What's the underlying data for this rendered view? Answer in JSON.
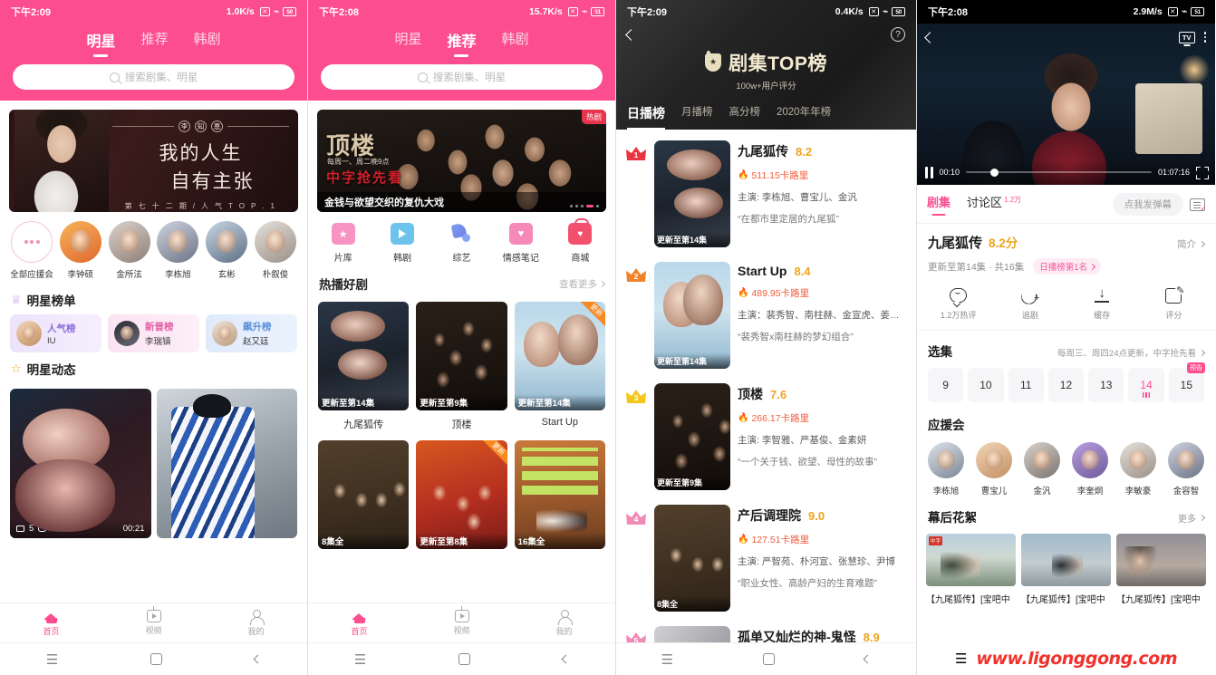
{
  "screen1": {
    "status": {
      "time": "下午2:09",
      "speed": "1.0K/s",
      "x_icon": "x-icon",
      "wifi": "wifi-icon",
      "battery": "50"
    },
    "tabs": [
      {
        "label": "明星",
        "active": true
      },
      {
        "label": "推荐",
        "active": false
      },
      {
        "label": "韩剧",
        "active": false
      }
    ],
    "search": {
      "placeholder": "搜索剧集、明星",
      "icon": "search-icon"
    },
    "banner": {
      "badge_chars": [
        "李",
        "知",
        "恩"
      ],
      "line1": "我的人生",
      "line2": "自有主张",
      "line3": "第 七 十 二 期 / 人 气 T O P . 1"
    },
    "avatars": [
      {
        "label": "全部应援会",
        "type": "more"
      },
      {
        "label": "李钟硕",
        "type": "photo"
      },
      {
        "label": "金所泫",
        "type": "photo"
      },
      {
        "label": "李栋旭",
        "type": "photo"
      },
      {
        "label": "玄彬",
        "type": "photo"
      },
      {
        "label": "朴叙俊",
        "type": "photo"
      }
    ],
    "star_rank": {
      "title": "明星榜单",
      "icon": "crown-icon",
      "cards": [
        {
          "name": "人气榜",
          "person": "IU"
        },
        {
          "name": "新晋榜",
          "person": "李瑞镇"
        },
        {
          "name": "飙升榜",
          "person": "赵又廷"
        }
      ]
    },
    "star_feed": {
      "title": "明星动态",
      "icon": "star-icon",
      "cards": [
        {
          "plays": "5",
          "comments": "0",
          "duration": "00:21"
        },
        {
          "plays": "",
          "comments": "",
          "duration": ""
        }
      ]
    },
    "tabbar": [
      {
        "label": "首页",
        "icon": "home-icon",
        "active": true
      },
      {
        "label": "视频",
        "icon": "tv-icon",
        "active": false
      },
      {
        "label": "我的",
        "icon": "person-icon",
        "active": false
      }
    ],
    "sysnav": [
      "menu-icon",
      "square-icon",
      "back-icon"
    ]
  },
  "screen2": {
    "status": {
      "time": "下午2:08",
      "speed": "15.7K/s",
      "battery": "51"
    },
    "tabs": [
      {
        "label": "明星",
        "active": false
      },
      {
        "label": "推荐",
        "active": true
      },
      {
        "label": "韩剧",
        "active": false
      }
    ],
    "search": {
      "placeholder": "搜索剧集、明星"
    },
    "banner": {
      "badge": "热剧",
      "title": "顶楼",
      "sub": "每周一、周二晚9点",
      "red": "中字抢先看",
      "footer": "金钱与欲望交织的复仇大戏"
    },
    "categories": [
      {
        "label": "片库",
        "icon": "folder-star-icon"
      },
      {
        "label": "韩剧",
        "icon": "play-icon"
      },
      {
        "label": "综艺",
        "icon": "mic-icon"
      },
      {
        "label": "情感笔记",
        "icon": "note-heart-icon"
      },
      {
        "label": "商城",
        "icon": "shop-bag-icon"
      }
    ],
    "hot": {
      "title": "热播好剧",
      "more": "查看更多",
      "row1": [
        {
          "name": "九尾狐传",
          "ep": "更新至第14集",
          "corner": ""
        },
        {
          "name": "顶楼",
          "ep": "更新至第9集",
          "corner": ""
        },
        {
          "name": "Start Up",
          "ep": "更新至第14集",
          "corner": "更新"
        }
      ],
      "row2": [
        {
          "name": "",
          "ep": "8集全",
          "corner": ""
        },
        {
          "name": "",
          "ep": "更新至第8集",
          "corner": "更新"
        },
        {
          "name": "",
          "ep": "16集全",
          "corner": ""
        }
      ]
    },
    "tabbar": [
      {
        "label": "首页",
        "active": true
      },
      {
        "label": "视频",
        "active": false
      },
      {
        "label": "我的",
        "active": false
      }
    ]
  },
  "screen3": {
    "status": {
      "time": "下午2:09",
      "speed": "0.4K/s",
      "battery": "50"
    },
    "header": {
      "back": "back-icon",
      "help": "?",
      "title": "剧集TOP榜",
      "medal": "medal-icon",
      "subtitle": "100w+用户评分"
    },
    "tabs": [
      {
        "label": "日播榜",
        "active": true
      },
      {
        "label": "月播榜",
        "active": false
      },
      {
        "label": "高分榜",
        "active": false
      },
      {
        "label": "2020年年榜",
        "active": false
      }
    ],
    "items": [
      {
        "rank": "1",
        "title": "九尾狐传",
        "score": "8.2",
        "heat": "511.15卡路里",
        "cast": "主演: 李栋旭、曹宝儿、金汎",
        "quote": "“在都市里定居的九尾狐”",
        "ep": "更新至第14集"
      },
      {
        "rank": "2",
        "title": "Start Up",
        "score": "8.4",
        "heat": "489.95卡路里",
        "cast": "主演：裴秀智、南柱赫、金宣虎、姜汉娜",
        "quote": "“裴秀智x南柱赫的梦幻组合”",
        "ep": "更新至第14集"
      },
      {
        "rank": "3",
        "title": "顶楼",
        "score": "7.6",
        "heat": "266.17卡路里",
        "cast": "主演: 李智雅、严基俊、金素妍",
        "quote": "“一个关于钱、欲望、母性的故事”",
        "ep": "更新至第9集"
      },
      {
        "rank": "4",
        "title": "产后调理院",
        "score": "9.0",
        "heat": "127.51卡路里",
        "cast": "主演: 严智苑、朴河宣、张慧珍、尹博",
        "quote": "“职业女性、高龄产妇的生育难题”",
        "ep": "8集全"
      },
      {
        "rank": "5",
        "title": "孤单又灿烂的神-鬼怪",
        "score": "8.9",
        "heat": "",
        "cast": "",
        "quote": "",
        "ep": ""
      }
    ]
  },
  "screen4": {
    "status": {
      "time": "下午2:08",
      "speed": "2.9M/s",
      "battery": "51"
    },
    "player": {
      "back": "back-icon",
      "tv": "TV",
      "more": "more-icon",
      "current": "00:10",
      "total": "01:07:16",
      "pause": "pause-icon",
      "fullscreen": "fullscreen-icon"
    },
    "tabs": [
      {
        "label": "剧集",
        "active": true,
        "count": ""
      },
      {
        "label": "讨论区",
        "active": false,
        "count": "1.2万"
      }
    ],
    "danmu": {
      "placeholder": "点我发弹幕",
      "icon": "danmaku-icon"
    },
    "head": {
      "name": "九尾狐传",
      "score": "8.2分",
      "intro": "简介",
      "episodes": "更新至第14集 · 共16集",
      "badge": "日播榜第1名"
    },
    "actions": [
      {
        "label": "1.2万热评",
        "icon": "comment-icon"
      },
      {
        "label": "追剧",
        "icon": "heart-plus-icon"
      },
      {
        "label": "缓存",
        "icon": "download-icon"
      },
      {
        "label": "评分",
        "icon": "rate-icon"
      }
    ],
    "episodes_section": {
      "title": "选集",
      "note": "每周三、周四24点更新，中字抢先看",
      "list": [
        {
          "n": "9",
          "state": "normal"
        },
        {
          "n": "10",
          "state": "normal"
        },
        {
          "n": "11",
          "state": "normal"
        },
        {
          "n": "12",
          "state": "normal"
        },
        {
          "n": "13",
          "state": "normal"
        },
        {
          "n": "14",
          "state": "current"
        },
        {
          "n": "15",
          "state": "preview",
          "tag": "预告"
        }
      ]
    },
    "fan_section": {
      "title": "应援会",
      "members": [
        "李栋旭",
        "曹宝儿",
        "金汎",
        "李奎炯",
        "李敏豪",
        "金容智"
      ]
    },
    "behind_section": {
      "title": "幕后花絮",
      "more": "更多",
      "items": [
        {
          "label": "【九尾狐传】[宝吧中"
        },
        {
          "label": "【九尾狐传】[宝吧中"
        },
        {
          "label": "【九尾狐传】[宝吧中"
        }
      ]
    },
    "watermark": "www.ligonggong.com"
  }
}
